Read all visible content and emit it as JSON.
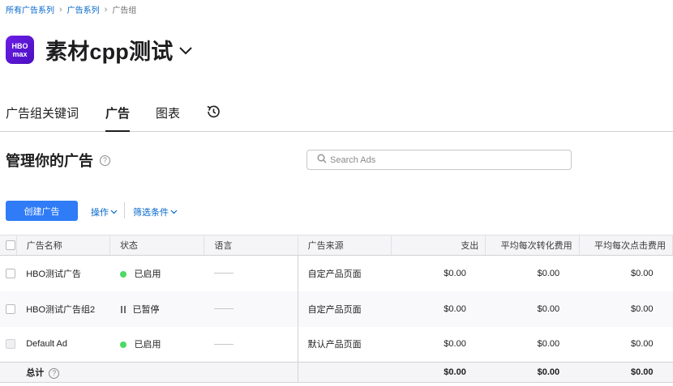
{
  "breadcrumb": [
    "所有广告系列",
    "广告系列",
    "广告组"
  ],
  "app": {
    "icon_text_top": "HBO",
    "icon_text_bottom": "max",
    "title": "素材cpp测试"
  },
  "tabs": [
    "广告组关键词",
    "广告",
    "图表"
  ],
  "section": {
    "title": "管理你的广告",
    "help": "?"
  },
  "search": {
    "placeholder": "Search Ads"
  },
  "toolbar": {
    "create_label": "创建广告",
    "actions_label": "操作",
    "filter_label": "筛选条件"
  },
  "table": {
    "columns": [
      "广告名称",
      "状态",
      "语言",
      "广告来源",
      "支出",
      "平均每次转化费用",
      "平均每次点击费用"
    ],
    "rows": [
      {
        "name": "HBO测试广告",
        "status": "已启用",
        "status_type": "enabled",
        "source": "自定产品页面",
        "spend": "$0.00",
        "cpa": "$0.00",
        "cpt": "$0.00"
      },
      {
        "name": "HBO测试广告组2",
        "status": "已暂停",
        "status_type": "paused",
        "source": "自定产品页面",
        "spend": "$0.00",
        "cpa": "$0.00",
        "cpt": "$0.00"
      },
      {
        "name": "Default Ad",
        "status": "已启用",
        "status_type": "enabled",
        "source": "默认产品页面",
        "spend": "$0.00",
        "cpa": "$0.00",
        "cpt": "$0.00"
      }
    ],
    "total": {
      "label": "总计",
      "help": "?",
      "spend": "$0.00",
      "cpa": "$0.00",
      "cpt": "$0.00"
    }
  },
  "colors": {
    "accent": "#2f7cf6",
    "link": "#0066cc",
    "enabled": "#4cd964",
    "icon_bg": "#5a16d9"
  }
}
